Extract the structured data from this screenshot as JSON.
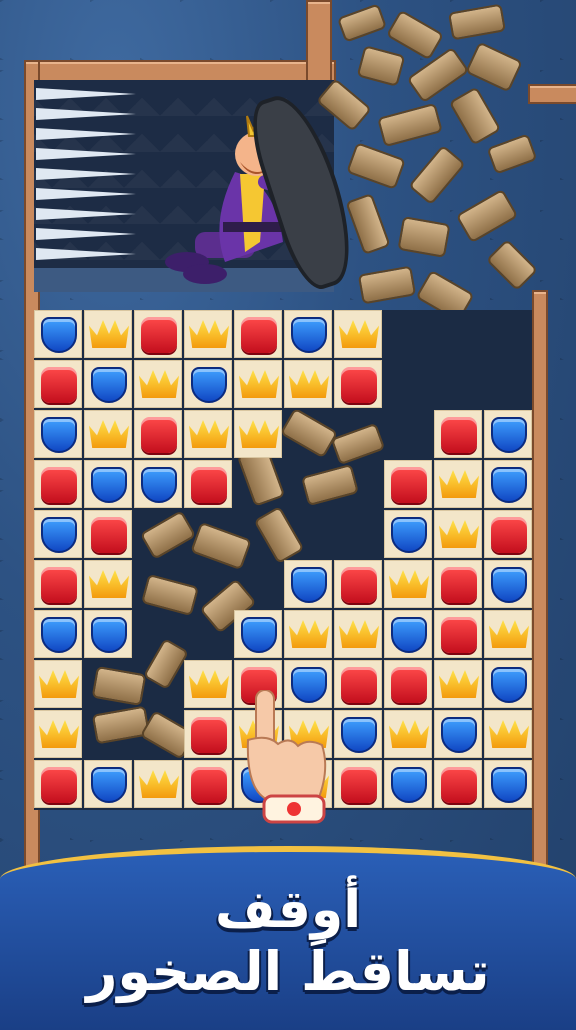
{
  "banner": {
    "line1": "أوقف",
    "line2": "تساقطَ الصخور"
  },
  "board": {
    "cols": 10,
    "rows": 10,
    "cells": [
      [
        "blue",
        "crown",
        "red",
        "crown",
        "red",
        "blue",
        "crown",
        null,
        null,
        null
      ],
      [
        "red",
        "blue",
        "crown",
        "blue",
        "crown",
        "crown",
        "red",
        null,
        null,
        null
      ],
      [
        "blue",
        "crown",
        "red",
        "crown",
        "crown",
        null,
        null,
        null,
        "red",
        "blue"
      ],
      [
        "red",
        "blue",
        "blue",
        "red",
        null,
        null,
        null,
        "red",
        "crown",
        "blue"
      ],
      [
        "blue",
        "red",
        null,
        null,
        null,
        null,
        null,
        "blue",
        "crown",
        "red"
      ],
      [
        "red",
        "crown",
        null,
        null,
        null,
        "blue",
        "red",
        "crown",
        "red",
        "blue"
      ],
      [
        "blue",
        "blue",
        null,
        null,
        "blue",
        "crown",
        "crown",
        "blue",
        "red",
        "crown"
      ],
      [
        "crown",
        null,
        null,
        "crown",
        "red",
        "blue",
        "red",
        "red",
        "crown",
        "blue"
      ],
      [
        "crown",
        null,
        null,
        "red",
        "crown",
        "crown",
        "blue",
        "crown",
        "blue",
        "crown"
      ],
      [
        "red",
        "blue",
        "crown",
        "red",
        "blue",
        "crown",
        "red",
        "blue",
        "red",
        "blue"
      ]
    ]
  },
  "colors": {
    "red": "#e8192c",
    "blue": "#1f6fe0",
    "crown": "#f7b51c",
    "banner": "#2a5fb7",
    "banner_trim": "#f2c142"
  },
  "icons": {
    "red": "red-gem-icon",
    "blue": "blue-shield-icon",
    "crown": "gold-crown-icon"
  }
}
